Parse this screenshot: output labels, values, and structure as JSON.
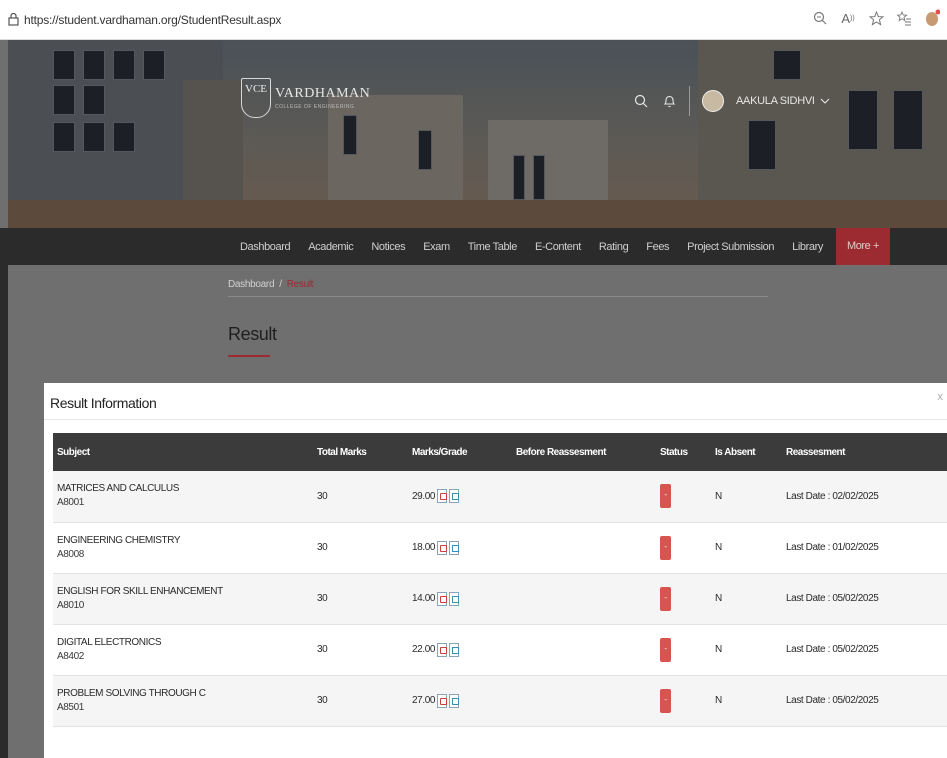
{
  "browser": {
    "url": "https://student.vardhaman.org/StudentResult.aspx",
    "icons": [
      "zoom-icon",
      "read-aloud-icon",
      "favorite-icon",
      "favorites-list-icon",
      "profile-icon"
    ]
  },
  "header": {
    "logo_badge": "VCE",
    "logo_name": "VARDHAMAN",
    "logo_sub": "COLLEGE OF ENGINEERING",
    "user_name": "AAKULA SIDHVI"
  },
  "nav": {
    "items": [
      "Dashboard",
      "Academic",
      "Notices",
      "Exam",
      "Time Table",
      "E-Content",
      "Rating",
      "Fees",
      "Project Submission",
      "Library"
    ],
    "more": "More +"
  },
  "breadcrumb": {
    "home": "Dashboard",
    "separator": "/",
    "current": "Result"
  },
  "page": {
    "title": "Result"
  },
  "modal": {
    "title": "Result Information",
    "close": "x",
    "columns": [
      "Subject",
      "Total Marks",
      "Marks/Grade",
      "Before Reassesment",
      "Status",
      "Is Absent",
      "Reassesment"
    ],
    "rows": [
      {
        "subject": "MATRICES AND CALCULUS",
        "code": "A8001",
        "total": "30",
        "marks": "29.00",
        "before": "",
        "status": "-",
        "absent": "N",
        "reassessment": "Last Date : 02/02/2025"
      },
      {
        "subject": "ENGINEERING CHEMISTRY",
        "code": "A8008",
        "total": "30",
        "marks": "18.00",
        "before": "",
        "status": "-",
        "absent": "N",
        "reassessment": "Last Date : 01/02/2025"
      },
      {
        "subject": "ENGLISH FOR SKILL ENHANCEMENT",
        "code": "A8010",
        "total": "30",
        "marks": "14.00",
        "before": "",
        "status": "-",
        "absent": "N",
        "reassessment": "Last Date : 05/02/2025"
      },
      {
        "subject": "DIGITAL ELECTRONICS",
        "code": "A8402",
        "total": "30",
        "marks": "22.00",
        "before": "",
        "status": "-",
        "absent": "N",
        "reassessment": "Last Date : 05/02/2025"
      },
      {
        "subject": "PROBLEM SOLVING THROUGH C",
        "code": "A8501",
        "total": "30",
        "marks": "27.00",
        "before": "",
        "status": "-",
        "absent": "N",
        "reassessment": "Last Date : 05/02/2025"
      }
    ]
  },
  "colors": {
    "accent": "#9b2b30",
    "navbar": "#2b2b2b",
    "table_header": "#3b3b3b",
    "status_button": "#d9534f"
  }
}
